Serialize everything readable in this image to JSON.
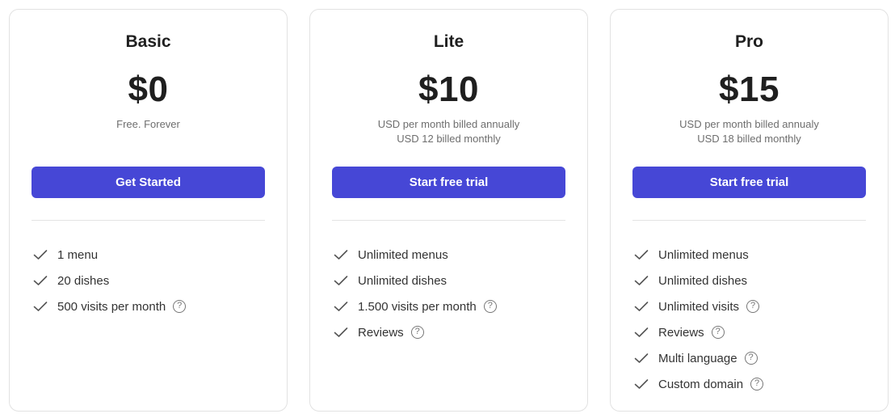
{
  "plans": [
    {
      "name": "Basic",
      "price": "$0",
      "subtitle_lines": [
        "Free. Forever"
      ],
      "cta_label": "Get Started",
      "features": [
        {
          "label": "1 menu",
          "help": false
        },
        {
          "label": "20 dishes",
          "help": false
        },
        {
          "label": "500 visits per month",
          "help": true
        }
      ]
    },
    {
      "name": "Lite",
      "price": "$10",
      "subtitle_lines": [
        "USD per month billed annually",
        "USD 12 billed monthly"
      ],
      "cta_label": "Start free trial",
      "features": [
        {
          "label": "Unlimited menus",
          "help": false
        },
        {
          "label": "Unlimited dishes",
          "help": false
        },
        {
          "label": "1.500 visits per month",
          "help": true
        },
        {
          "label": "Reviews",
          "help": true
        }
      ]
    },
    {
      "name": "Pro",
      "price": "$15",
      "subtitle_lines": [
        "USD per month billed annualy",
        "USD 18 billed monthly"
      ],
      "cta_label": "Start free trial",
      "features": [
        {
          "label": "Unlimited menus",
          "help": false
        },
        {
          "label": "Unlimited dishes",
          "help": false
        },
        {
          "label": "Unlimited visits",
          "help": true
        },
        {
          "label": "Reviews",
          "help": true
        },
        {
          "label": "Multi language",
          "help": true
        },
        {
          "label": "Custom domain",
          "help": true
        }
      ]
    }
  ],
  "icons": {
    "check": "check-icon",
    "help": "question-circle-icon",
    "help_glyph": "?"
  },
  "colors": {
    "accent": "#4647d6",
    "heading": "#1f1f1f",
    "muted": "#6e6e6e",
    "border": "#e2e2e2"
  }
}
